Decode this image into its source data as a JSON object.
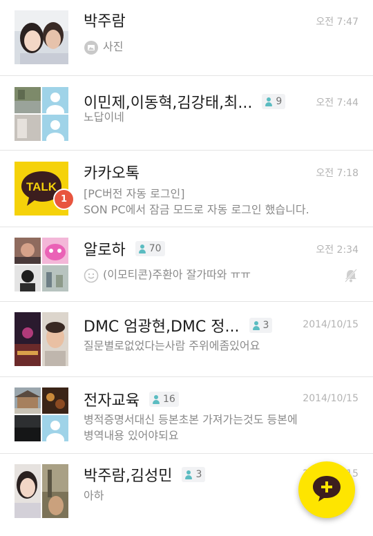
{
  "chats": [
    {
      "title": "박주람",
      "time": "오전 7:47",
      "message": "사진",
      "message_icon": "photo-icon"
    },
    {
      "title": "이민제,이동혁,김강태,최...",
      "members": "9",
      "time": "오전 7:44",
      "message": "노답이네"
    },
    {
      "title": "카카오톡",
      "time": "오전 7:18",
      "message_lines": [
        "[PC버전 자동 로그인]",
        "SON PC에서 잠금 모드로 자동 로그인 했습니다."
      ],
      "unread": "1",
      "avatar_text": "TALK"
    },
    {
      "title": "알로하",
      "members": "70",
      "time": "오전 2:34",
      "message": "(이모티콘)주환아 잘가따와 ㅠㅠ",
      "message_icon": "emoticon-icon",
      "muted": true
    },
    {
      "title": "DMC 엄광현,DMC 정...",
      "members": "3",
      "time": "2014/10/15",
      "message": "질문별로없었다는사람 주위에좀있어요"
    },
    {
      "title": "전자교육",
      "members": "16",
      "time": "2014/10/15",
      "message_lines": [
        "병적증명서대신 등본초본 가져가는것도 등본에",
        "병역내용 있어야되요"
      ]
    },
    {
      "title": "박주람,김성민",
      "members": "3",
      "time": "2014/10/15",
      "message": "아하"
    }
  ],
  "colors": {
    "kakao_yellow": "#fee500",
    "badge_red": "#e8553f",
    "member_icon": "#5bbcc1"
  },
  "fab": {
    "icon": "new-chat-plus-icon"
  }
}
